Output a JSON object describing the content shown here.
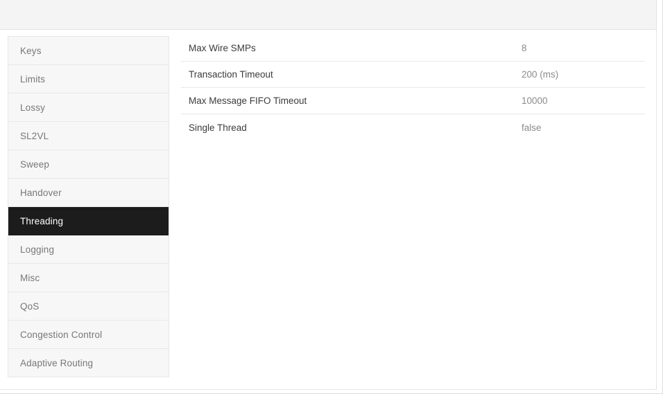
{
  "window": {
    "header_bar": ""
  },
  "sidebar": {
    "items": [
      {
        "label": "Keys",
        "active": false
      },
      {
        "label": "Limits",
        "active": false
      },
      {
        "label": "Lossy",
        "active": false
      },
      {
        "label": "SL2VL",
        "active": false
      },
      {
        "label": "Sweep",
        "active": false
      },
      {
        "label": "Handover",
        "active": false
      },
      {
        "label": "Threading",
        "active": true
      },
      {
        "label": "Logging",
        "active": false
      },
      {
        "label": "Misc",
        "active": false
      },
      {
        "label": "QoS",
        "active": false
      },
      {
        "label": "Congestion Control",
        "active": false
      },
      {
        "label": "Adaptive Routing",
        "active": false
      }
    ]
  },
  "settings": {
    "rows": [
      {
        "label": "Max Wire SMPs",
        "value": "8"
      },
      {
        "label": "Transaction Timeout",
        "value": "200 (ms)"
      },
      {
        "label": "Max Message FIFO Timeout",
        "value": "10000"
      },
      {
        "label": "Single Thread",
        "value": "false"
      }
    ]
  },
  "colors": {
    "active_nav_background": "#1c1c1c",
    "active_nav_text": "#ffffff",
    "nav_background": "#f7f7f7",
    "nav_text": "#777777",
    "header_bar": "#f4f4f4",
    "label_text": "#3b3b3b",
    "value_text": "#8b8b8b",
    "divider": "#e8e8e8"
  }
}
